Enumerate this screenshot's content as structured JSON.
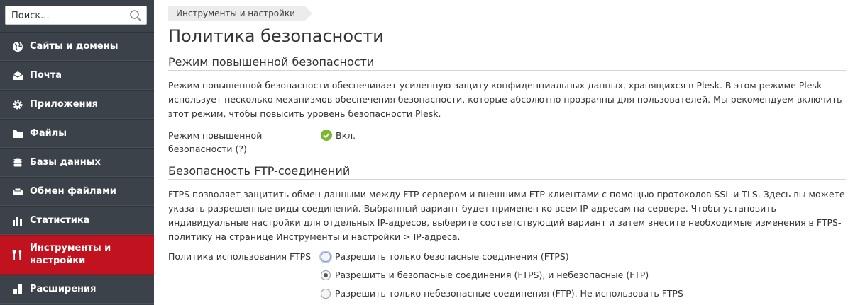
{
  "search": {
    "placeholder": "Поиск..."
  },
  "sidebar": {
    "items": [
      {
        "label": "Сайты и домены",
        "icon": "globe-icon"
      },
      {
        "label": "Почта",
        "icon": "envelope-icon"
      },
      {
        "label": "Приложения",
        "icon": "gear-icon"
      },
      {
        "label": "Файлы",
        "icon": "folder-icon"
      },
      {
        "label": "Базы данных",
        "icon": "database-icon"
      },
      {
        "label": "Обмен файлами",
        "icon": "file-sharing-icon"
      },
      {
        "label": "Статистика",
        "icon": "bar-chart-icon"
      },
      {
        "label": "Инструменты и настройки",
        "icon": "tools-icon",
        "active": true
      },
      {
        "label": "Расширения",
        "icon": "extensions-icon"
      }
    ]
  },
  "breadcrumb": "Инструменты и настройки",
  "page_title": "Политика безопасности",
  "enhanced": {
    "title": "Режим повышенной безопасности",
    "description": "Режим повышенной безопасности обеспечивает усиленную защиту конфиденциальных данных, хранящихся в Plesk. В этом режиме Plesk использует несколько механизмов обеспечения безопасности, которые абсолютно прозрачны для пользователей. Мы рекомендуем включить этот режим, чтобы повысить уровень безопасности Plesk.",
    "field_label_line1": "Режим повышенной",
    "field_label_line2": "безопасности (?)",
    "status": "Вкл."
  },
  "ftp": {
    "title": "Безопасность FTP-соединений",
    "description": "FTPS позволяет защитить обмен данными между FTP-сервером и внешними FTP-клиентами с помощью протоколов SSL и TLS. Здесь вы можете указать разрешенные виды соединений. Выбранный вариант будет применен ко всем IP-адресам на сервере. Чтобы установить индивидуальные настройки для отдельных IP-адресов, выберите соответствующий вариант и затем внесите необходимые изменения в FTPS-политику на странице Инструменты и настройки > IP-адреса.",
    "policy_label": "Политика использования FTPS",
    "options": [
      {
        "label": "Разрешить только безопасные соединения (FTPS)",
        "checked": false
      },
      {
        "label": "Разрешить и безопасные соединения (FTPS), и небезопасные (FTP)",
        "checked": true
      },
      {
        "label": "Разрешить только небезопасные соединения (FTP). Не использовать FTPS",
        "checked": false
      }
    ]
  },
  "colors": {
    "sidebar_bg": "#3c4249",
    "active_bg": "#c1121f",
    "ok_green": "#7cb82f"
  }
}
